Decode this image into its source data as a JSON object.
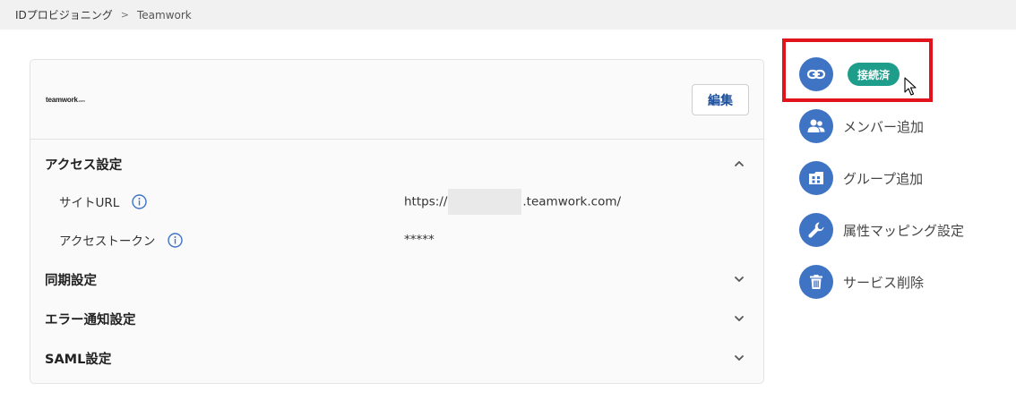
{
  "breadcrumb": {
    "root": "IDプロビジョニング",
    "separator": ">",
    "current": "Teamwork"
  },
  "card": {
    "logo_text": "teamwork",
    "logo_suffix": ".com",
    "edit_label": "編集",
    "sections": [
      {
        "title": "アクセス設定",
        "expanded": true
      },
      {
        "title": "同期設定",
        "expanded": false
      },
      {
        "title": "エラー通知設定",
        "expanded": false
      },
      {
        "title": "SAML設定",
        "expanded": false
      }
    ],
    "fields": [
      {
        "label": "サイトURL",
        "value_prefix": "https://",
        "value_suffix": ".teamwork.com/"
      },
      {
        "label": "アクセストークン",
        "value": "*****"
      }
    ]
  },
  "actions": {
    "connection_status": "接続済",
    "items": [
      {
        "label": "メンバー追加",
        "icon": "users-icon"
      },
      {
        "label": "グループ追加",
        "icon": "group-icon"
      },
      {
        "label": "属性マッピング設定",
        "icon": "wrench-icon"
      },
      {
        "label": "サービス削除",
        "icon": "trash-icon"
      }
    ]
  },
  "colors": {
    "accent_blue": "#3f73c4",
    "badge_teal": "#1e9d8b",
    "highlight_red": "#e1141b",
    "edit_text": "#1c4f9c"
  }
}
